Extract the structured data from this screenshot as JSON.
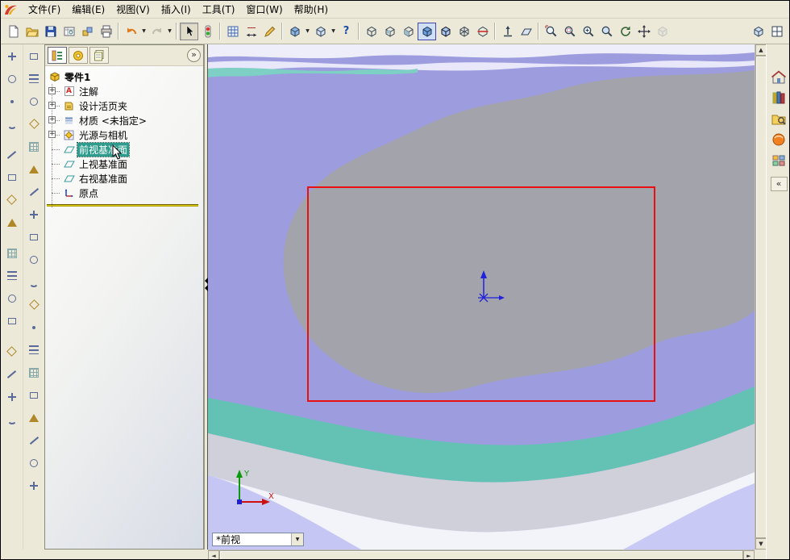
{
  "menu_bar": {
    "items": [
      {
        "label": "文件(F)"
      },
      {
        "label": "编辑(E)"
      },
      {
        "label": "视图(V)"
      },
      {
        "label": "插入(I)"
      },
      {
        "label": "工具(T)"
      },
      {
        "label": "窗口(W)"
      },
      {
        "label": "帮助(H)"
      }
    ]
  },
  "feature_tree": {
    "root_label": "零件1",
    "expander": "+",
    "expand_panel_glyph": "»",
    "items": [
      {
        "label": "注解"
      },
      {
        "label": "设计活页夹"
      },
      {
        "label": "材质 <未指定>"
      },
      {
        "label": "光源与相机"
      },
      {
        "label": "前视基准面",
        "selected": true
      },
      {
        "label": "上视基准面"
      },
      {
        "label": "右视基准面"
      },
      {
        "label": "原点"
      }
    ]
  },
  "viewport": {
    "view_selector_value": "*前视",
    "triad_x_label": "X",
    "triad_y_label": "Y"
  },
  "task_pane": {
    "collapse_glyph": "«"
  },
  "glyphs": {
    "caret": "▼",
    "up": "▲",
    "down": "▼",
    "left": "◄",
    "right": "►",
    "help": "?",
    "annotation_a": "A"
  },
  "colors": {
    "chrome_bg": "#ece9d8",
    "selection_teal": "#2d9c8c",
    "sketch_outline_red": "#e81010",
    "viewport_purple": "#9c9cdf",
    "viewport_gray": "#a3a3ab",
    "viewport_teal": "#63c2b4",
    "rollback_bar_yellow": "#cdb700"
  }
}
